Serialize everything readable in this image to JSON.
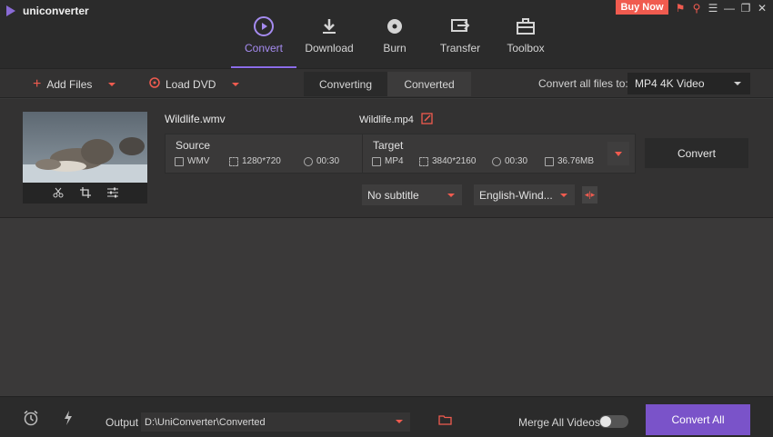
{
  "app": {
    "name": "uniconverter"
  },
  "header": {
    "buy_now": "Buy Now",
    "nav": [
      {
        "label": "Convert",
        "icon": "convert-icon",
        "active": true
      },
      {
        "label": "Download",
        "icon": "download-icon",
        "active": false
      },
      {
        "label": "Burn",
        "icon": "burn-icon",
        "active": false
      },
      {
        "label": "Transfer",
        "icon": "transfer-icon",
        "active": false
      },
      {
        "label": "Toolbox",
        "icon": "toolbox-icon",
        "active": false
      }
    ]
  },
  "toolbar": {
    "add_files": "Add Files",
    "load_dvd": "Load DVD",
    "tabs": [
      "Converting",
      "Converted"
    ],
    "active_tab": "Converting",
    "convert_all_label": "Convert all files to:",
    "format": "MP4 4K Video"
  },
  "file": {
    "source_name": "Wildlife.wmv",
    "target_name": "Wildlife.mp4",
    "source": {
      "title": "Source",
      "format": "WMV",
      "resolution": "1280*720",
      "duration": "00:30"
    },
    "target": {
      "title": "Target",
      "format": "MP4",
      "resolution": "3840*2160",
      "duration": "00:30",
      "size": "36.76MB"
    },
    "convert_button": "Convert",
    "subtitle": "No subtitle",
    "audio": "English-Wind..."
  },
  "bottom": {
    "output_label": "Output",
    "output_path": "D:\\UniConverter\\Converted",
    "merge_label": "Merge All Videos",
    "merge_enabled": false,
    "convert_all": "Convert All"
  },
  "colors": {
    "accent": "#8b6ce8",
    "red": "#f05b4f",
    "convert_all_bg": "#7a53c9"
  }
}
